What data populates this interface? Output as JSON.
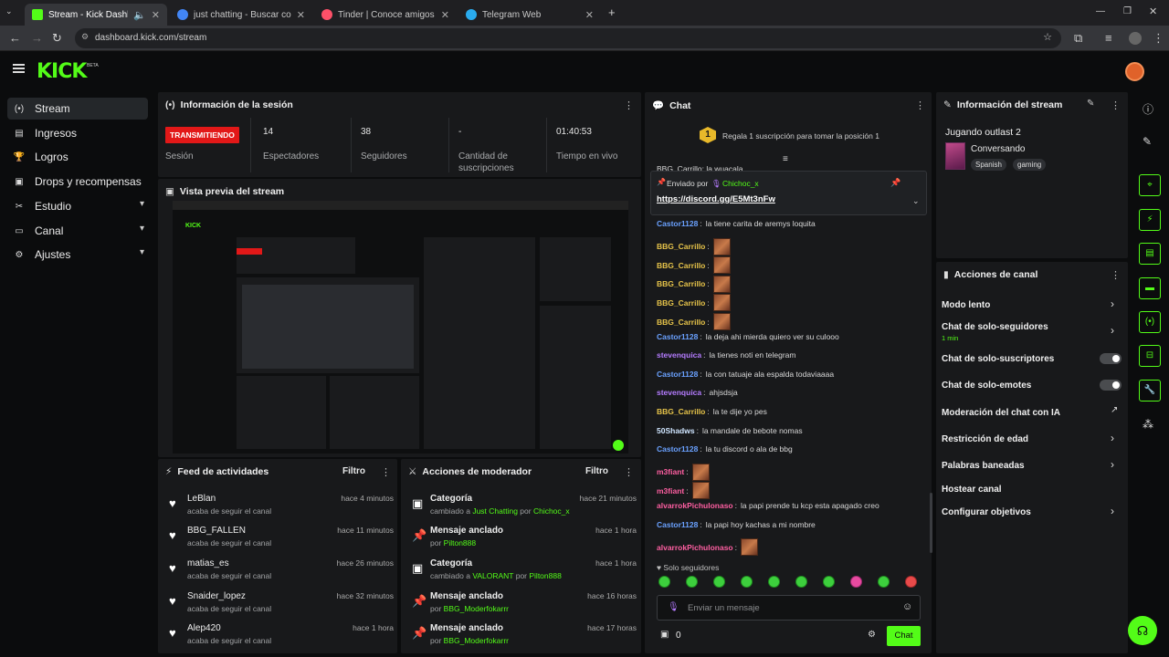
{
  "browser": {
    "tabs": [
      {
        "title": "Stream - Kick Dashboard",
        "active": true
      },
      {
        "title": "just chatting - Buscar con Goog"
      },
      {
        "title": "Tinder | Conoce amigos y gent"
      },
      {
        "title": "Telegram Web"
      }
    ],
    "url": "dashboard.kick.com/stream"
  },
  "app": {
    "logo": "KICK",
    "beta": "BETA"
  },
  "sidebar": {
    "items": [
      {
        "label": "Stream",
        "icon": "broadcast-icon"
      },
      {
        "label": "Ingresos",
        "icon": "wallet-icon"
      },
      {
        "label": "Logros",
        "icon": "trophy-icon"
      },
      {
        "label": "Drops y recompensas",
        "icon": "gift-icon"
      },
      {
        "label": "Estudio",
        "icon": "studio-icon"
      },
      {
        "label": "Canal",
        "icon": "channel-icon"
      },
      {
        "label": "Ajustes",
        "icon": "gear-icon"
      }
    ]
  },
  "session": {
    "title": "Información de la sesión",
    "status_badge": "TRANSMITIENDO",
    "status_label": "Sesión",
    "stats": [
      {
        "value": "14",
        "label": "Espectadores"
      },
      {
        "value": "38",
        "label": "Seguidores"
      },
      {
        "value": "-",
        "label": "Cantidad de suscripciones"
      },
      {
        "value": "01:40:53",
        "label": "Tiempo en vivo"
      }
    ]
  },
  "preview": {
    "title": "Vista previa del stream"
  },
  "feed": {
    "title": "Feed de actividades",
    "filter": "Filtro",
    "items": [
      {
        "name": "LeBlan",
        "sub": "acaba de seguir el canal",
        "time": "hace 4 minutos"
      },
      {
        "name": "BBG_FALLEN",
        "sub": "acaba de seguir el canal",
        "time": "hace 11 minutos"
      },
      {
        "name": "matias_es",
        "sub": "acaba de seguir el canal",
        "time": "hace 26 minutos"
      },
      {
        "name": "Snaider_lopez",
        "sub": "acaba de seguir el canal",
        "time": "hace 32 minutos"
      },
      {
        "name": "Alep420",
        "sub": "acaba de seguir el canal",
        "time": "hace 1 hora"
      }
    ]
  },
  "modactions": {
    "title": "Acciones de moderador",
    "filter": "Filtro",
    "items": [
      {
        "name": "Categoría",
        "sub_pre": "cambiado a ",
        "sub_a": "Just Chatting",
        "sub_mid": " por ",
        "sub_b": "Chichoc_x",
        "time": "hace 21 minutos",
        "icon": "category-icon"
      },
      {
        "name": "Mensaje anclado",
        "sub_pre": "por ",
        "sub_a": "Pilton888",
        "sub_mid": "",
        "sub_b": "",
        "time": "hace 1 hora",
        "icon": "pin-icon"
      },
      {
        "name": "Categoría",
        "sub_pre": "cambiado a ",
        "sub_a": "VALORANT",
        "sub_mid": " por ",
        "sub_b": "Pilton888",
        "time": "hace 1 hora",
        "icon": "category-icon"
      },
      {
        "name": "Mensaje anclado",
        "sub_pre": "por ",
        "sub_a": "BBG_Moderfokarrr",
        "sub_mid": "",
        "sub_b": "",
        "time": "hace 16 horas",
        "icon": "pin-icon"
      },
      {
        "name": "Mensaje anclado",
        "sub_pre": "por ",
        "sub_a": "BBG_Moderfokarrr",
        "sub_mid": "",
        "sub_b": "",
        "time": "hace 17 horas",
        "icon": "pin-icon"
      }
    ]
  },
  "chat": {
    "title": "Chat",
    "gift_rank": "1",
    "gift_text": "Regala 1 suscripción para tomar la posición 1",
    "pinned": {
      "by_label": "Enviado por",
      "by_user": "Chichoc_x",
      "link": "https://discord.gg/E5Mt3nFw"
    },
    "partial_top": "BBG_Carrillo: la wuacala",
    "messages": [
      {
        "user": "Castor1128",
        "text": "la tiene carita de aremys loquita",
        "cls": "u2",
        "emote": false
      },
      {
        "user": "BBG_Carrillo",
        "text": "",
        "cls": "u1",
        "emote": true
      },
      {
        "user": "BBG_Carrillo",
        "text": "",
        "cls": "u1",
        "emote": true
      },
      {
        "user": "BBG_Carrillo",
        "text": "",
        "cls": "u1",
        "emote": true
      },
      {
        "user": "BBG_Carrillo",
        "text": "",
        "cls": "u1",
        "emote": true
      },
      {
        "user": "BBG_Carrillo",
        "text": "",
        "cls": "u1",
        "emote": true
      },
      {
        "user": "Castor1128",
        "text": "la deja ahi mierda quiero ver su culooo",
        "cls": "u2",
        "emote": false
      },
      {
        "user": "stevenquica",
        "text": "la tienes noti en telegram",
        "cls": "u3",
        "emote": false
      },
      {
        "user": "Castor1128",
        "text": "la con tatuaje ala espalda todaviaaaa",
        "cls": "u2",
        "emote": false
      },
      {
        "user": "stevenquica",
        "text": "ahjsdsja",
        "cls": "u3",
        "emote": false
      },
      {
        "user": "BBG_Carrillo",
        "text": "la te dije yo pes",
        "cls": "u1",
        "emote": false
      },
      {
        "user": "50Shadws",
        "text": "la mandale de bebote nomas",
        "cls": "u5",
        "emote": false
      },
      {
        "user": "Castor1128",
        "text": "la tu discord o ala de bbg",
        "cls": "u2",
        "emote": false
      },
      {
        "user": "m3fiant",
        "text": "",
        "cls": "u4",
        "emote": true
      },
      {
        "user": "m3fiant",
        "text": "",
        "cls": "u4",
        "emote": true
      },
      {
        "user": "alvarrokPichulonaso",
        "text": "la papi prende tu kcp esta apagado creo",
        "cls": "u4",
        "emote": false
      },
      {
        "user": "Castor1128",
        "text": "la papi hoy kachas a mi nombre",
        "cls": "u2",
        "emote": false
      },
      {
        "user": "alvarrokPichulonaso",
        "text": "",
        "cls": "u4",
        "emote": true
      }
    ],
    "followers_only": "Solo seguidores",
    "input_placeholder": "Enviar un mensaje",
    "count": "0",
    "send_label": "Chat"
  },
  "stream_info": {
    "title": "Información del stream",
    "stream_title": "Jugando outlast 2",
    "category": "Conversando",
    "tags": [
      "Spanish",
      "gaming"
    ]
  },
  "channel_actions": {
    "title": "Acciones de canal",
    "items": [
      {
        "label": "Modo lento",
        "sub": "",
        "control": "chevron"
      },
      {
        "label": "Chat de solo-seguidores",
        "sub": "1 min",
        "control": "chevron"
      },
      {
        "label": "Chat de solo-suscriptores",
        "sub": "",
        "control": "toggle"
      },
      {
        "label": "Chat de solo-emotes",
        "sub": "",
        "control": "toggle"
      },
      {
        "label": "Moderación del chat con IA",
        "sub": "",
        "control": "external"
      },
      {
        "label": "Restricción de edad",
        "sub": "",
        "control": "chevron"
      },
      {
        "label": "Palabras baneadas",
        "sub": "",
        "control": "chevron"
      },
      {
        "label": "Hostear canal",
        "sub": "",
        "control": "none"
      },
      {
        "label": "Configurar objetivos",
        "sub": "",
        "control": "chevron"
      }
    ]
  },
  "colors": {
    "accent": "#53fc18",
    "live": "#e21818",
    "panel": "#18191b"
  }
}
